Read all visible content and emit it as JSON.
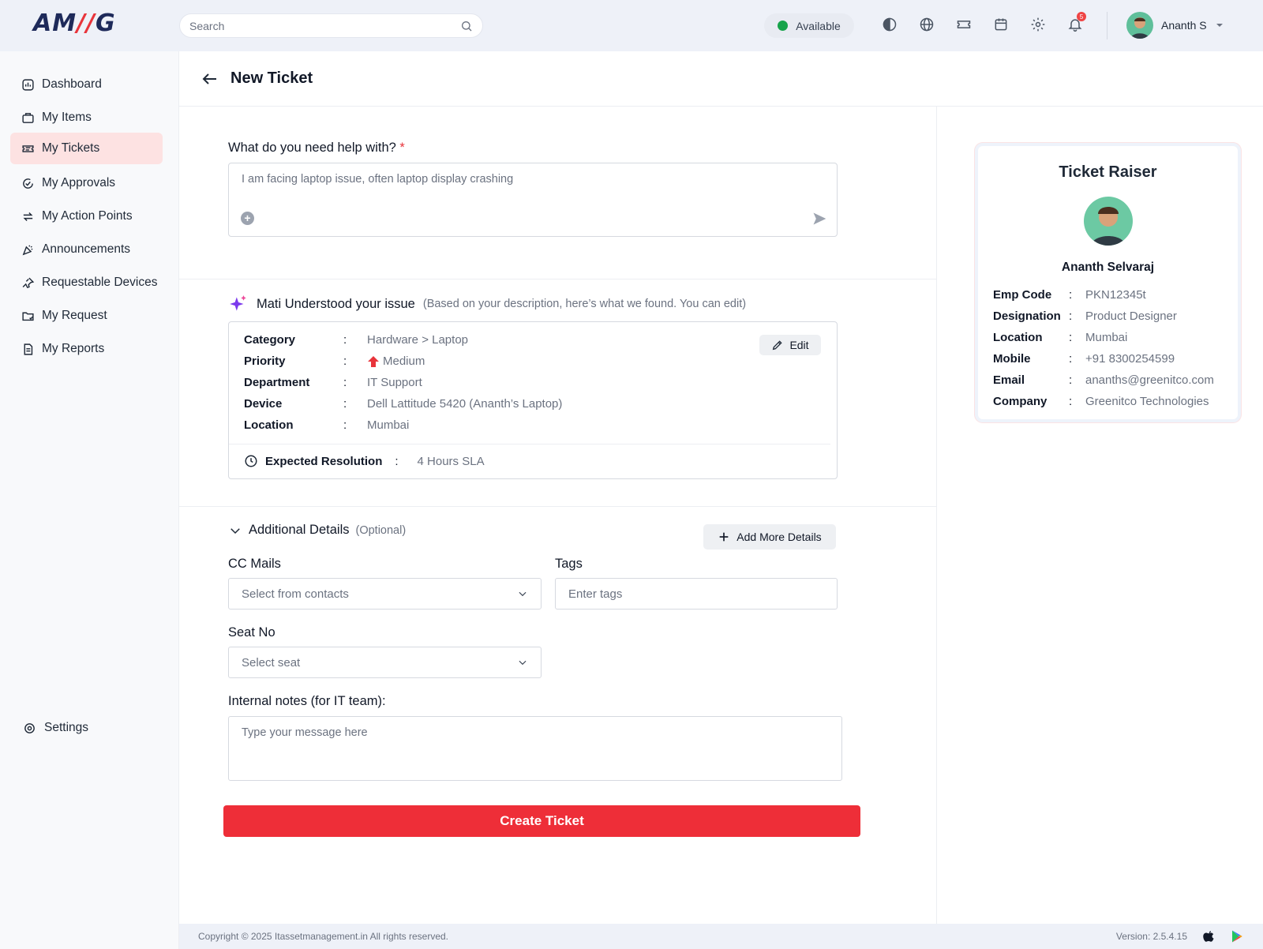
{
  "brand": {
    "logo_left": "AM",
    "logo_slash": "//",
    "logo_right": "G"
  },
  "header": {
    "search_placeholder": "Search",
    "status": "Available",
    "notification_count": "5",
    "user_name": "Ananth S"
  },
  "sidebar": {
    "items": [
      {
        "label": "Dashboard",
        "icon": "dashboard-icon"
      },
      {
        "label": "My Items",
        "icon": "briefcase-icon"
      },
      {
        "label": "My Tickets",
        "icon": "ticket-icon",
        "active": true
      },
      {
        "label": "My Approvals",
        "icon": "approval-icon"
      },
      {
        "label": "My Action Points",
        "icon": "arrows-icon"
      },
      {
        "label": "Announcements",
        "icon": "party-icon"
      },
      {
        "label": "Requestable Devices",
        "icon": "pin-icon"
      },
      {
        "label": "My Request",
        "icon": "folder-icon"
      },
      {
        "label": "My Reports",
        "icon": "report-icon"
      }
    ],
    "settings_label": "Settings"
  },
  "page": {
    "title": "New Ticket"
  },
  "help": {
    "question": "What do you need help with?",
    "required_mark": "*",
    "text": "I am facing laptop issue, often laptop display crashing"
  },
  "mati": {
    "title": "Mati Understood your issue",
    "subtitle": "(Based on your description, here’s what we found. You can edit)",
    "edit_label": "Edit",
    "fields": [
      {
        "key": "Category",
        "value": "Hardware > Laptop"
      },
      {
        "key": "Priority",
        "value": "Medium"
      },
      {
        "key": "Department",
        "value": "IT Support"
      },
      {
        "key": "Device",
        "value": "Dell Lattitude 5420 (Ananth’s Laptop)"
      },
      {
        "key": "Location",
        "value": "Mumbai"
      }
    ],
    "resolution_label": "Expected Resolution",
    "resolution_value": "4 Hours SLA",
    "colon": ":"
  },
  "additional": {
    "title": "Additional Details",
    "optional": "(Optional)",
    "add_more_label": "Add More Details",
    "cc_label": "CC Mails",
    "cc_placeholder": "Select from contacts",
    "tags_label": "Tags",
    "tags_placeholder": "Enter tags",
    "seat_label": "Seat No",
    "seat_placeholder": "Select seat",
    "notes_label": "Internal notes (for IT team):",
    "notes_placeholder": "Type your message here"
  },
  "create_label": "Create Ticket",
  "raiser": {
    "title": "Ticket Raiser",
    "name": "Ananth Selvaraj",
    "fields": [
      {
        "key": "Emp Code",
        "value": "PKN12345t"
      },
      {
        "key": "Designation",
        "value": "Product Designer"
      },
      {
        "key": "Location",
        "value": "Mumbai"
      },
      {
        "key": "Mobile",
        "value": "+91 8300254599"
      },
      {
        "key": "Email",
        "value": "ananths@greenitco.com"
      },
      {
        "key": "Company",
        "value": "Greenitco Technologies"
      }
    ]
  },
  "footer": {
    "copyright": "Copyright © 2025 Itassetmanagement.in All rights reserved.",
    "version": "Version: 2.5.4.15"
  },
  "colors": {
    "accent": "#ee2e38",
    "active_bg": "#fde2e2",
    "brand_navy": "#1e2a5a",
    "status_green": "#16a34a"
  }
}
